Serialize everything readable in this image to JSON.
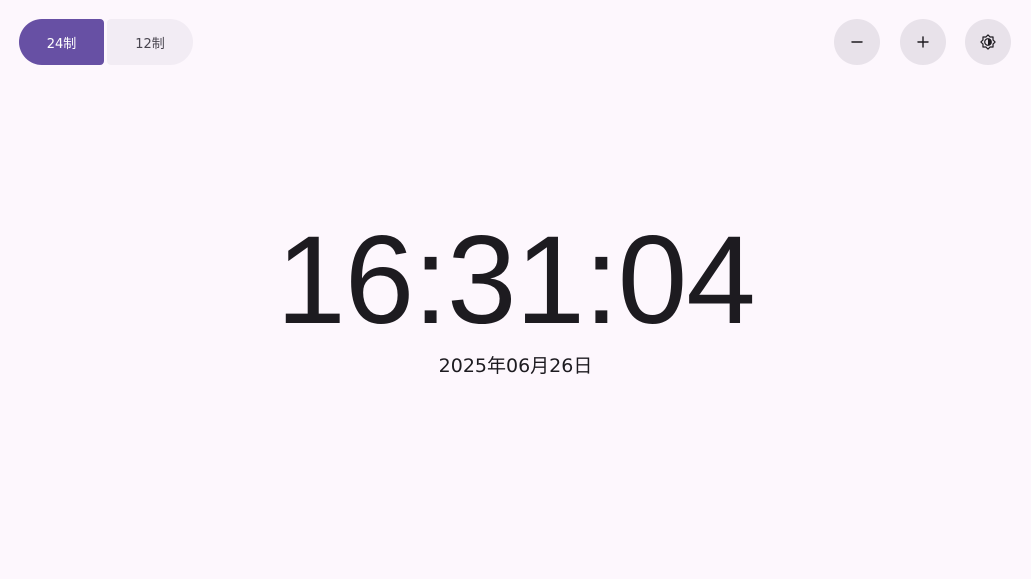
{
  "format_toggle": {
    "options": [
      {
        "label": "24制",
        "selected": true
      },
      {
        "label": "12制",
        "selected": false
      }
    ]
  },
  "actions": {
    "decrease_icon": "minus-icon",
    "increase_icon": "plus-icon",
    "theme_icon": "brightness-auto-icon"
  },
  "clock": {
    "time": "16:31:04",
    "date": "2025年06月26日"
  },
  "colors": {
    "background": "#fdf7fd",
    "accent": "#6750a4",
    "unselected_segment": "#f2ecf4",
    "icon_button": "#e8e2ea",
    "text": "#1d1b20"
  }
}
